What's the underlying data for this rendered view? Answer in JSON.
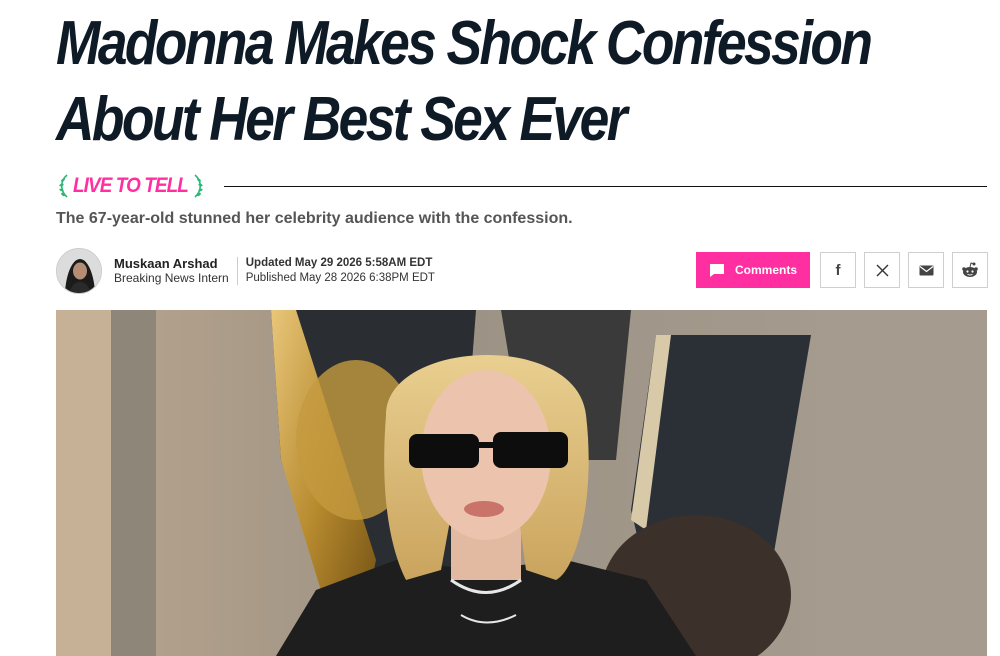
{
  "article": {
    "headline": "Madonna Makes Shock Confession About Her Best Sex Ever",
    "rubric": "LIVE TO TELL",
    "subhead": "The 67-year-old stunned her celebrity audience with the confession.",
    "author": {
      "name": "Muskaan Arshad",
      "role": "Breaking News Intern"
    },
    "updated": "Updated May 29 2026 5:58AM EDT",
    "published": "Published May 28 2026 6:38PM EDT"
  },
  "actions": {
    "comments_label": "Comments",
    "share_icons": [
      "facebook-icon",
      "x-icon",
      "email-icon",
      "reddit-icon"
    ]
  },
  "colors": {
    "accent": "#ff2fa2",
    "headline": "#0e1a26",
    "rubric_laurel": "#2bb673"
  }
}
